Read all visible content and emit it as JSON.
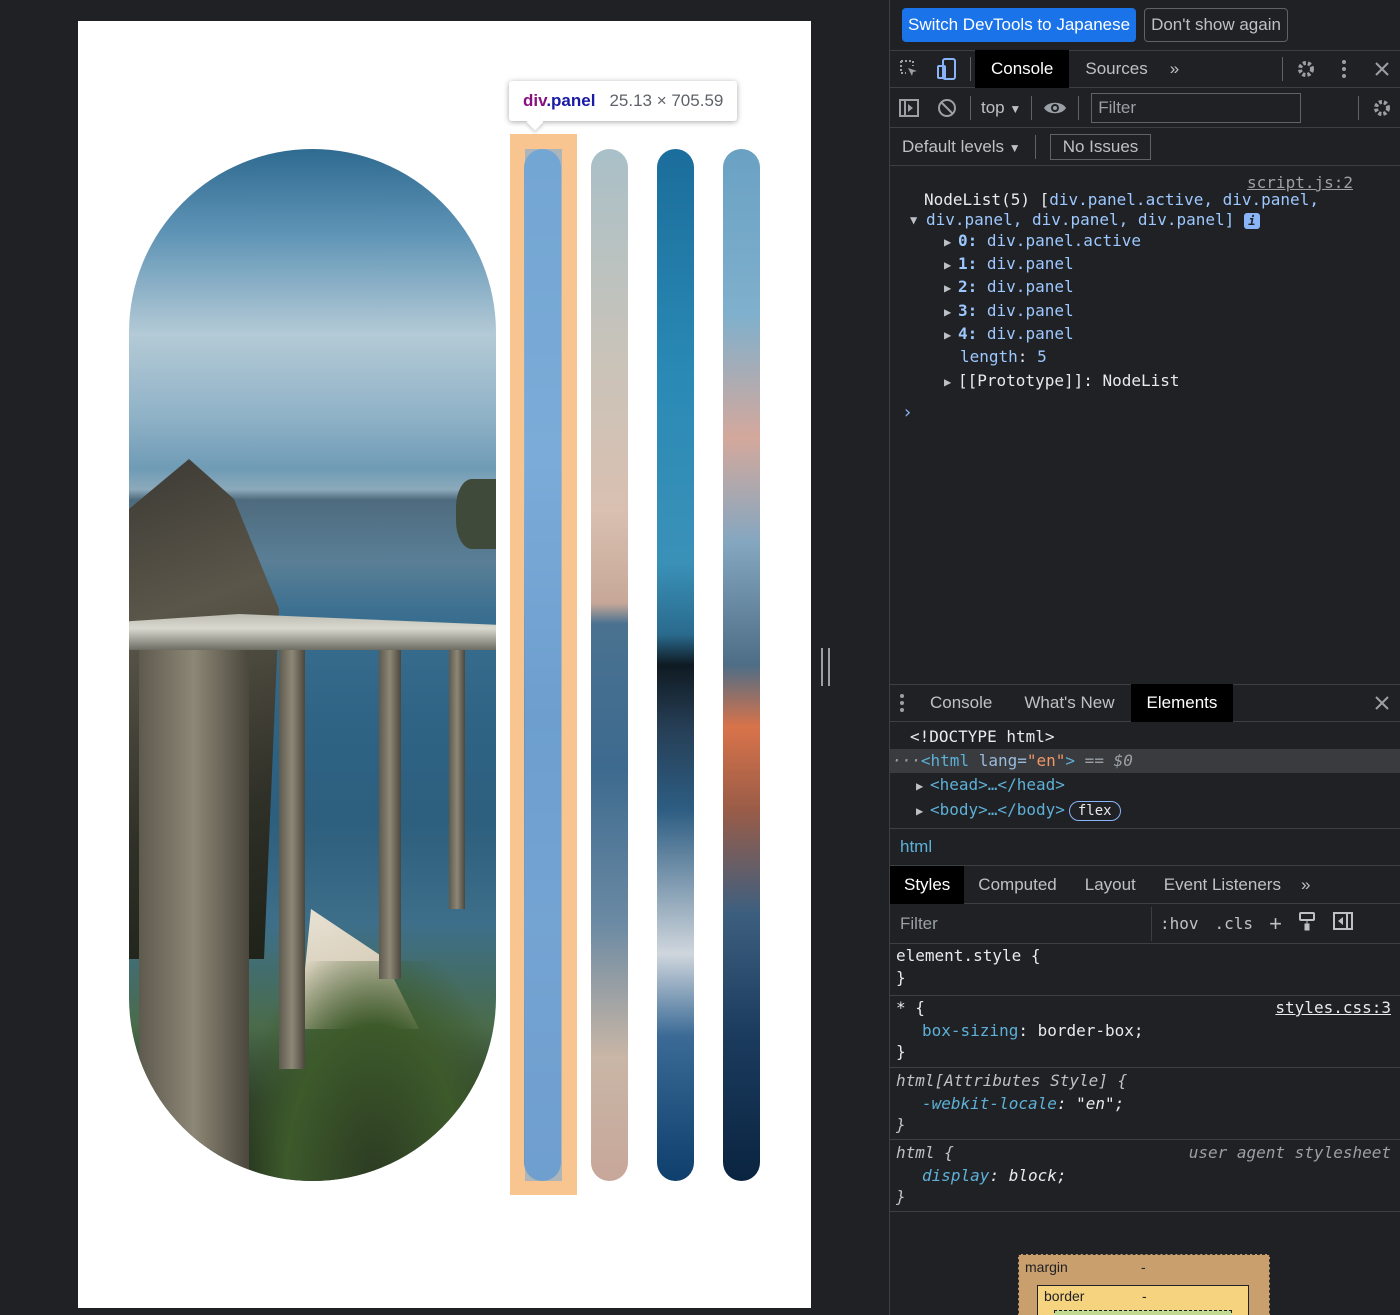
{
  "tooltip": {
    "tag": "div",
    "class": ".panel",
    "dims": "25.13 × 705.59"
  },
  "devtools": {
    "lang_bar": {
      "switch_label": "Switch DevTools to Japanese",
      "dismiss_label": "Don't show again"
    },
    "main_tabs": [
      {
        "label": "Console",
        "active": true
      },
      {
        "label": "Sources",
        "active": false
      }
    ],
    "more_tabs_glyph": "»",
    "console_toolbar": {
      "context": "top",
      "filter_placeholder": "Filter",
      "levels": "Default levels",
      "issues": "No Issues"
    },
    "console_log": {
      "source": "script.js:2",
      "header_a": "NodeList(5) [",
      "header_items": "div.panel.active, div.panel,",
      "header_b": "div.panel, div.panel, div.panel]",
      "info_badge": "i",
      "entries": [
        {
          "key": "0:",
          "value": "div.panel.active"
        },
        {
          "key": "1:",
          "value": "div.panel"
        },
        {
          "key": "2:",
          "value": "div.panel"
        },
        {
          "key": "3:",
          "value": "div.panel"
        },
        {
          "key": "4:",
          "value": "div.panel"
        }
      ],
      "length_key": "length",
      "length_value": "5",
      "proto_key": "[[Prototype]]",
      "proto_value": "NodeList",
      "prompt": "›"
    },
    "drawer_tabs": [
      {
        "label": "Console",
        "active": false
      },
      {
        "label": "What's New",
        "active": false
      },
      {
        "label": "Elements",
        "active": true
      }
    ],
    "elements_tree": {
      "doctype": "<!DOCTYPE html>",
      "html_open": "<html",
      "html_attr": " lang=",
      "html_val": "\"en\"",
      "html_close": ">",
      "html_eq": " == $0",
      "head": "<head>…</head>",
      "body": "<body>…</body>",
      "flex_badge": "flex"
    },
    "breadcrumb": "html",
    "styles_tabs": [
      {
        "label": "Styles",
        "active": true
      },
      {
        "label": "Computed",
        "active": false
      },
      {
        "label": "Layout",
        "active": false
      },
      {
        "label": "Event Listeners",
        "active": false
      }
    ],
    "styles_filter_placeholder": "Filter",
    "styles_buttons": {
      "hov": ":hov",
      "cls": ".cls",
      "add": "+"
    },
    "rules": {
      "element_style": {
        "selector": "element.style {",
        "close": "}"
      },
      "universal": {
        "selector": "* {",
        "source": "styles.css:3",
        "prop": "box-sizing",
        "value": "border-box;",
        "close": "}"
      },
      "attr_style": {
        "selector": "html[Attributes Style] {",
        "prop": "-webkit-locale",
        "value": "\"en\";",
        "close": "}"
      },
      "ua_html": {
        "selector": "html {",
        "source": "user agent stylesheet",
        "prop": "display",
        "value": "block;",
        "close": "}"
      }
    },
    "box_model": {
      "margin_label": "margin",
      "margin_value": "-",
      "border_label": "border",
      "border_value": "-"
    }
  }
}
